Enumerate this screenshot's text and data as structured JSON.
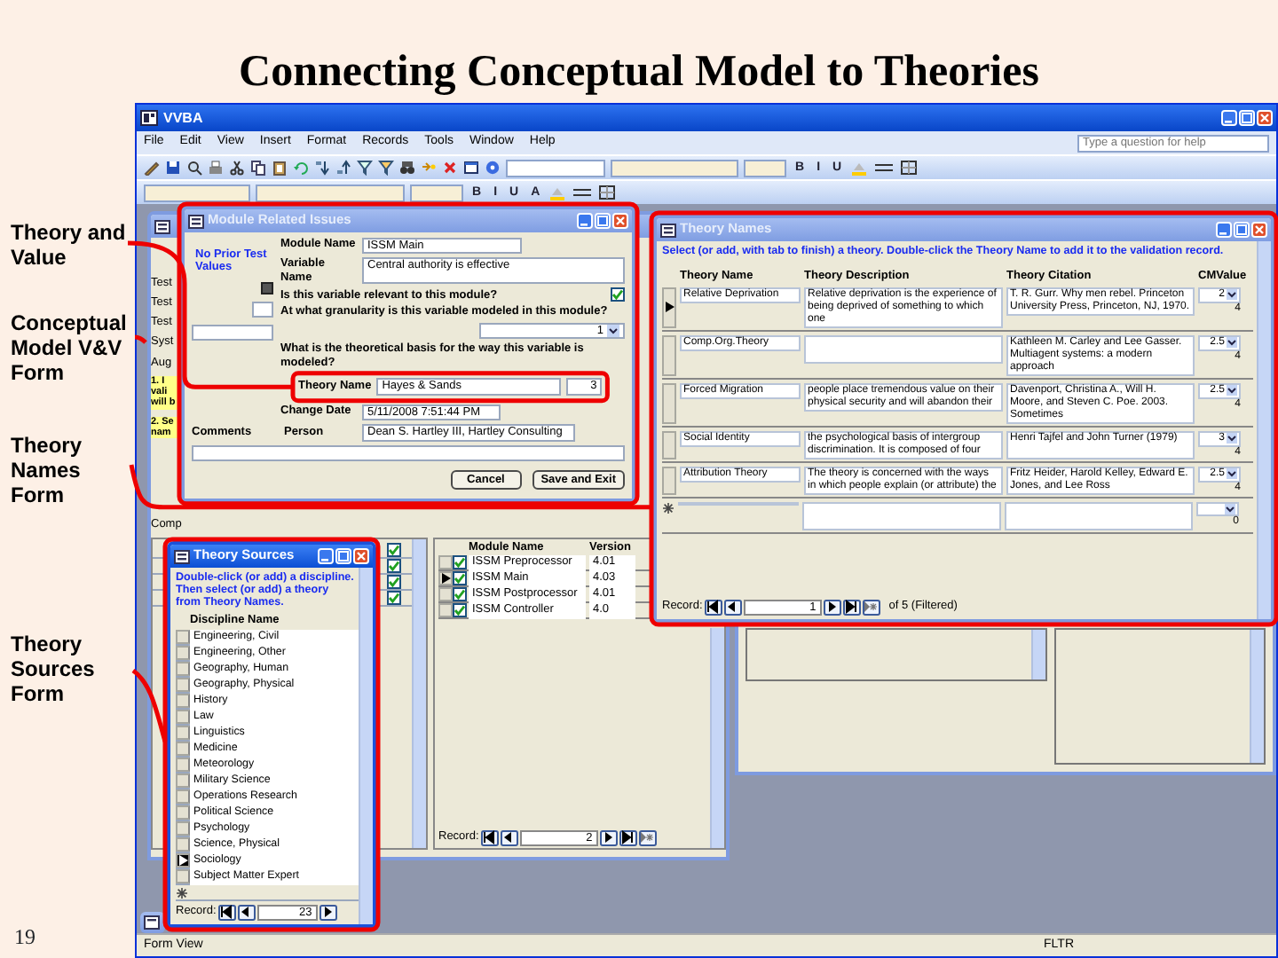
{
  "slide": {
    "title": "Connecting Conceptual Model to Theories",
    "number": "19"
  },
  "callouts": [
    {
      "label": "Theory and Value"
    },
    {
      "label": "Conceptual Model V&V Form"
    },
    {
      "label": "Theory Names Form"
    },
    {
      "label": "Theory Sources Form"
    }
  ],
  "app": {
    "title": "VVBA",
    "menu": [
      "File",
      "Edit",
      "View",
      "Insert",
      "Format",
      "Records",
      "Tools",
      "Window",
      "Help"
    ],
    "help_placeholder": "Type a question for help",
    "toolbar_format": [
      "B",
      "I",
      "U"
    ],
    "toolbar2_format": [
      "B",
      "I",
      "U",
      "A"
    ],
    "status_bar": {
      "mode": "Form View",
      "indicator": "FLTR"
    }
  },
  "vv_form": {
    "active": false,
    "fragments": [
      "Test",
      "Test",
      "Test",
      "Syst",
      "Aug"
    ],
    "notes": [
      [
        "1. I",
        "vali",
        "will b"
      ],
      [
        "2. Se",
        "nam"
      ]
    ],
    "footer_fragment": "Comp",
    "checks": [
      {
        "checked": true
      },
      {
        "checked": true
      },
      {
        "checked": true
      },
      {
        "checked": true
      }
    ],
    "modules": {
      "columns": [
        "Module Name",
        "Version"
      ],
      "rows": [
        {
          "name": "ISSM Preprocessor",
          "version": "4.01",
          "checked": true,
          "selected": false
        },
        {
          "name": "ISSM Main",
          "version": "4.03",
          "checked": true,
          "selected": true
        },
        {
          "name": "ISSM Postprocessor",
          "version": "4.01",
          "checked": true,
          "selected": false
        },
        {
          "name": "ISSM Controller",
          "version": "4.0",
          "checked": true,
          "selected": false
        }
      ]
    },
    "record_label": "Record:",
    "record": "2"
  },
  "dialog": {
    "title": "Module Related Issues",
    "active": false,
    "prior_note": "No Prior Test Values",
    "module_label": "Module Name",
    "module": "ISSM Main",
    "variable_label": "Variable Name",
    "variable": "Central authority is effective",
    "relevant_question": "Is this variable relevant to this module?",
    "relevant_checked": true,
    "granularity_question": "At what granularity is this variable modeled in this module?",
    "granularity": "1",
    "basis_question": "What is the theoretical basis for the way this variable is modeled?",
    "theory_label": "Theory Name",
    "theory": "Hayes & Sands",
    "theory_value": "3",
    "date_label": "Change Date",
    "date": "5/11/2008 7:51:44 PM",
    "comments_label": "Comments",
    "person_label": "Person",
    "person": "Dean S. Hartley III, Hartley Consulting",
    "buttons": [
      "Cancel",
      "Save and Exit"
    ]
  },
  "theory_names": {
    "title": "Theory Names",
    "active": false,
    "instruction": "Select (or add, with tab to finish) a theory.  Double-click the Theory Name to add it to the validation record.",
    "columns": [
      "Theory Name",
      "Theory Description",
      "Theory Citation",
      "CMValue"
    ],
    "rows": [
      {
        "name": "Relative Deprivation",
        "description": "Relative deprivation is the experience of being deprived of something to which one",
        "citation": "T. R. Gurr. Why men rebel. Princeton University Press, Princeton, NJ, 1970.",
        "cm_value": "2",
        "count": "4",
        "selected": true
      },
      {
        "name": "Comp.Org.Theory",
        "description": "",
        "citation": "Kathleen M. Carley and Lee Gasser. Multiagent systems: a modern approach",
        "cm_value": "2.5",
        "count": "4",
        "selected": false
      },
      {
        "name": "Forced Migration",
        "description": "people place tremendous value on their physical security and will abandon their",
        "citation": "Davenport, Christina A., Will H. Moore, and Steven C. Poe.  2003.  Sometimes",
        "cm_value": "2.5",
        "count": "4",
        "selected": false
      },
      {
        "name": "Social Identity",
        "description": "the psychological basis of intergroup discrimination. It is composed of four",
        "citation": "Henri Tajfel and John Turner (1979)",
        "cm_value": "3",
        "count": "4",
        "selected": false
      },
      {
        "name": "Attribution Theory",
        "description": "The theory is concerned with the ways in which people explain (or attribute) the",
        "citation": "Fritz Heider, Harold Kelley, Edward E. Jones, and Lee Ross",
        "cm_value": "2.5",
        "count": "4",
        "selected": false
      }
    ],
    "new_row_count": "0",
    "record_label": "Record:",
    "record": "1",
    "record_total": "of  5 (Filtered)"
  },
  "theory_sources": {
    "title": "Theory Sources",
    "active": true,
    "instruction": "Double-click (or add) a discipline.  Then select (or add) a theory from Theory Names.",
    "column": "Discipline Name",
    "items": [
      {
        "name": "Engineering, Civil",
        "selected": false
      },
      {
        "name": "Engineering, Other",
        "selected": false
      },
      {
        "name": "Geography, Human",
        "selected": false
      },
      {
        "name": "Geography, Physical",
        "selected": false
      },
      {
        "name": "History",
        "selected": false
      },
      {
        "name": "Law",
        "selected": false
      },
      {
        "name": "Linguistics",
        "selected": false
      },
      {
        "name": "Medicine",
        "selected": false
      },
      {
        "name": "Meteorology",
        "selected": false
      },
      {
        "name": "Military Science",
        "selected": false
      },
      {
        "name": "Operations Research",
        "selected": false
      },
      {
        "name": "Political Science",
        "selected": false
      },
      {
        "name": "Psychology",
        "selected": false
      },
      {
        "name": "Science, Physical",
        "selected": false
      },
      {
        "name": "Sociology",
        "selected": true
      },
      {
        "name": "Subject Matter Expert",
        "selected": false
      }
    ],
    "record_label": "Record:",
    "record": "23"
  }
}
